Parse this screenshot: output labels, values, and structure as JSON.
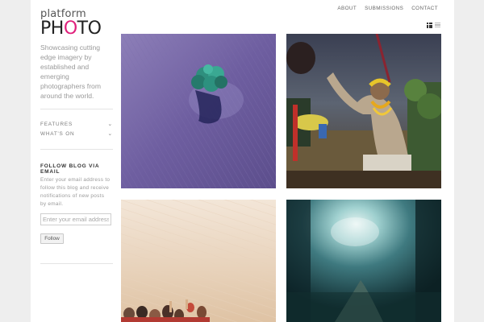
{
  "site": {
    "logo_line1": "platform",
    "logo_photo_prefix": "PH",
    "logo_photo_accent": "O",
    "logo_photo_suffix": "TO",
    "tagline": "Showcasing cutting edge imagery by established and emerging photographers from around the world."
  },
  "sidebar": {
    "menu": [
      {
        "label": "FEATURES",
        "icon": "chevron-down-icon"
      },
      {
        "label": "WHAT'S ON",
        "icon": "chevron-down-icon"
      }
    ],
    "follow_widget": {
      "title": "FOLLOW BLOG VIA EMAIL",
      "text": "Enter your email address to follow this blog and receive notifications of new posts by email.",
      "placeholder": "Enter your email address",
      "button_label": "Follow"
    }
  },
  "topnav": {
    "items": [
      "ABOUT",
      "SUBMISSIONS",
      "CONTACT"
    ]
  },
  "view_toggle": {
    "grid_icon": "grid-view-icon",
    "list_icon": "list-view-icon",
    "active": "grid"
  },
  "photos": [
    {
      "name": "photo-aerial-tree-field"
    },
    {
      "name": "photo-holy-man-procession"
    },
    {
      "name": "photo-sand-crowd"
    },
    {
      "name": "photo-sunlit-forest-road"
    }
  ],
  "colors": {
    "brand_accent": "#e0217c",
    "page_background": "#eeeeee",
    "content_background": "#ffffff"
  }
}
